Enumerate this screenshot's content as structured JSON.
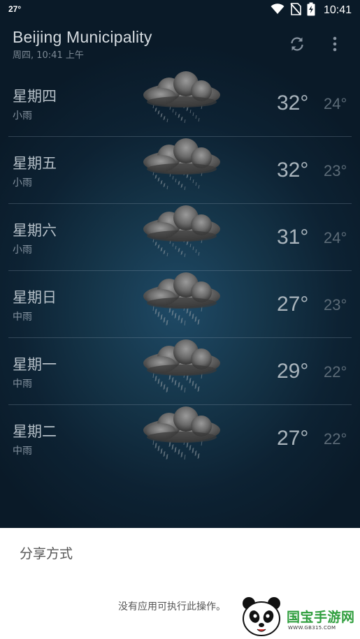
{
  "status_bar": {
    "temperature": "27°",
    "time": "10:41",
    "icons": [
      "wifi-icon",
      "no-sim-icon",
      "battery-charging-icon"
    ]
  },
  "app_bar": {
    "title": "Beijing Municipality",
    "subtitle": "周四, 10:41 上午",
    "actions": [
      "refresh-icon",
      "more-vert-icon"
    ]
  },
  "forecast": [
    {
      "day": "星期四",
      "condition": "小雨",
      "high": "32°",
      "low": "24°",
      "icon": "light-rain-cloud-icon"
    },
    {
      "day": "星期五",
      "condition": "小雨",
      "high": "32°",
      "low": "23°",
      "icon": "light-rain-cloud-icon"
    },
    {
      "day": "星期六",
      "condition": "小雨",
      "high": "31°",
      "low": "24°",
      "icon": "light-rain-cloud-icon"
    },
    {
      "day": "星期日",
      "condition": "中雨",
      "high": "27°",
      "low": "23°",
      "icon": "moderate-rain-cloud-icon"
    },
    {
      "day": "星期一",
      "condition": "中雨",
      "high": "29°",
      "low": "22°",
      "icon": "moderate-rain-cloud-icon"
    },
    {
      "day": "星期二",
      "condition": "中雨",
      "high": "27°",
      "low": "22°",
      "icon": "moderate-rain-cloud-icon"
    }
  ],
  "share_sheet": {
    "title": "分享方式",
    "empty_message": "没有应用可执行此操作。"
  },
  "watermark": {
    "name": "国宝手游网",
    "url": "WWW.GB315.COM"
  },
  "colors": {
    "background": "#12304a",
    "share_sheet": "#ffffff",
    "watermark_green": "#2f9e3d"
  }
}
